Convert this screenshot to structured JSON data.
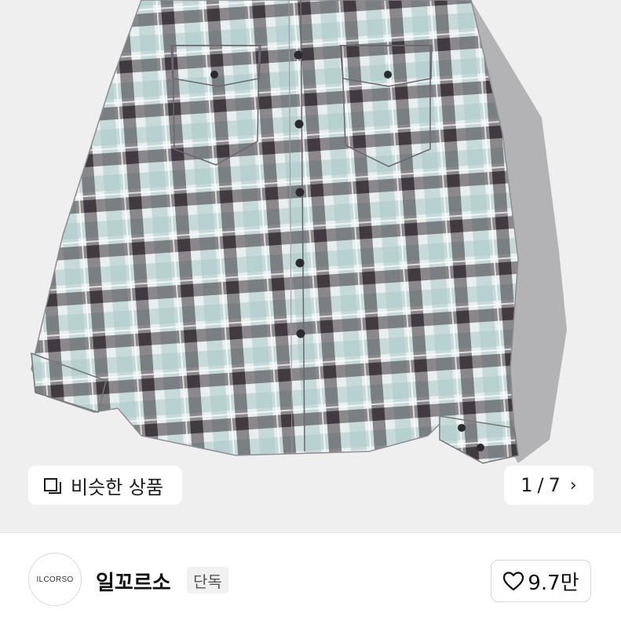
{
  "gallery": {
    "similar_label": "비슷한 상품",
    "current_index": "1",
    "separator": "/",
    "total": "7",
    "next_icon": "chevron-right-icon",
    "similar_icon": "similar-items-icon"
  },
  "seller": {
    "avatar_text": "ILCORSO",
    "name": "일꼬르소",
    "badge": "단독"
  },
  "like": {
    "icon": "heart-outline-icon",
    "count": "9.7만"
  },
  "colors": {
    "image_bg": "#efefef",
    "plaid_dark": "#3c353b",
    "plaid_mint": "#a9c9c8",
    "plaid_light": "#e9eeee"
  }
}
